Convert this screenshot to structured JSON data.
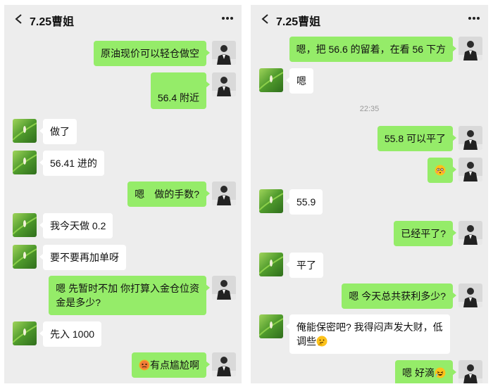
{
  "left_panel": {
    "title": "7.25曹姐",
    "messages": [
      {
        "side": "sent",
        "text": "原油现价可以轻仓做空"
      },
      {
        "side": "sent",
        "text": "56.4 附近"
      },
      {
        "side": "recv",
        "text": "做了"
      },
      {
        "side": "recv",
        "text": "56.41 进的"
      },
      {
        "side": "sent",
        "text": "嗯　做的手数?"
      },
      {
        "side": "recv",
        "text": "我今天做 0.2"
      },
      {
        "side": "recv",
        "text": "要不要再加单呀"
      },
      {
        "side": "sent",
        "line1": "嗯  先暂时不加  你打算入金仓位资",
        "line2": "金是多少?"
      },
      {
        "side": "recv",
        "text": "先入 1000"
      },
      {
        "side": "sent",
        "text": "有点尴尬啊",
        "emoji": "embarrassed-emoji"
      }
    ]
  },
  "right_panel": {
    "title": "7.25曹姐",
    "timestamp": "22:35",
    "messages": [
      {
        "side": "sent",
        "text": "嗯，把 56.6 的留着，在看 56 下方"
      },
      {
        "side": "recv",
        "text": "嗯"
      },
      {
        "side": "sent",
        "text": "55.8 可以平了"
      },
      {
        "side": "sent",
        "text": "",
        "emoji": "flushed-emoji"
      },
      {
        "side": "recv",
        "text": "55.9"
      },
      {
        "side": "sent",
        "text": "已经平了?"
      },
      {
        "side": "recv",
        "text": "平了"
      },
      {
        "side": "sent",
        "text": "嗯  今天总共获利多少?"
      },
      {
        "side": "recv",
        "line1": "俺能保密吧? 我得闷声发大财，低",
        "line2": "调些"
      },
      {
        "side": "sent",
        "text": "嗯  好滴"
      }
    ]
  },
  "colors": {
    "sent_bubble": "#95ec69",
    "recv_bubble": "#ffffff",
    "background": "#ededed"
  }
}
